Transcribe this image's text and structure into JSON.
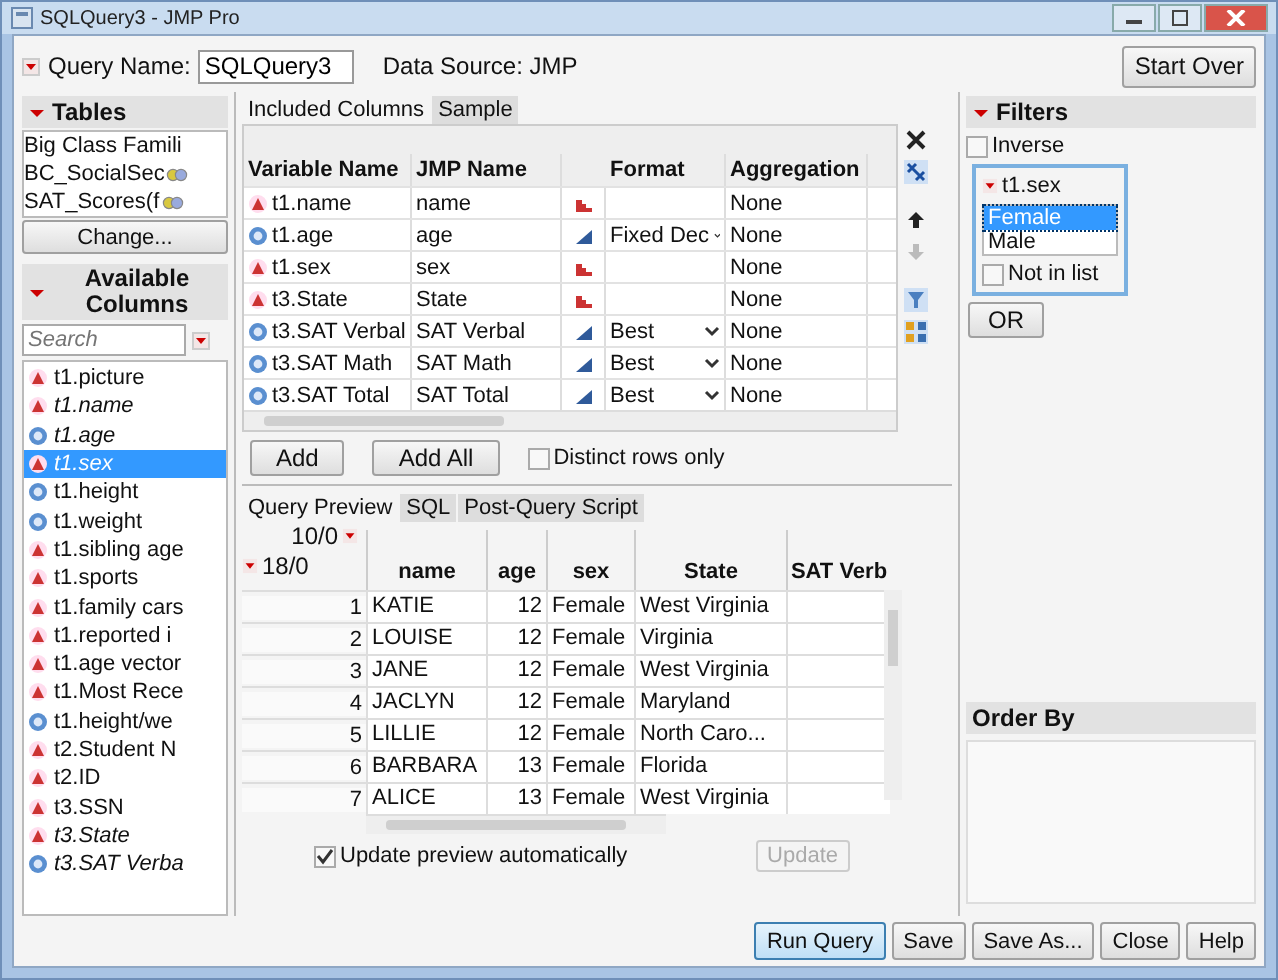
{
  "window": {
    "title": "SQLQuery3 - JMP Pro"
  },
  "query_name": {
    "label": "Query Name:",
    "value": "SQLQuery3"
  },
  "data_source": "Data Source:  JMP",
  "start_over": "Start Over",
  "tables": {
    "title": "Tables",
    "items": [
      {
        "name": "Big Class Famili",
        "linked": false
      },
      {
        "name": "BC_SocialSec",
        "linked": true
      },
      {
        "name": "SAT_Scores(f",
        "linked": true
      }
    ],
    "button": "Change..."
  },
  "available": {
    "title": "Available Columns",
    "search_placeholder": "Search",
    "items": [
      {
        "name": "t1.picture",
        "kind": "nominal",
        "included": false,
        "selected": false
      },
      {
        "name": "t1.name",
        "kind": "nominal",
        "included": true,
        "selected": false
      },
      {
        "name": "t1.age",
        "kind": "continuous",
        "included": true,
        "selected": false
      },
      {
        "name": "t1.sex",
        "kind": "nominal",
        "included": true,
        "selected": true
      },
      {
        "name": "t1.height",
        "kind": "continuous",
        "included": false,
        "selected": false
      },
      {
        "name": "t1.weight",
        "kind": "continuous",
        "included": false,
        "selected": false
      },
      {
        "name": "t1.sibling age",
        "kind": "nominal",
        "included": false,
        "selected": false
      },
      {
        "name": "t1.sports",
        "kind": "nominal",
        "included": false,
        "selected": false
      },
      {
        "name": "t1.family cars",
        "kind": "nominal",
        "included": false,
        "selected": false
      },
      {
        "name": "t1.reported i",
        "kind": "nominal",
        "included": false,
        "selected": false
      },
      {
        "name": "t1.age vector",
        "kind": "nominal",
        "included": false,
        "selected": false
      },
      {
        "name": "t1.Most Rece",
        "kind": "nominal",
        "included": false,
        "selected": false
      },
      {
        "name": "t1.height/we",
        "kind": "continuous",
        "included": false,
        "selected": false
      },
      {
        "name": "t2.Student N",
        "kind": "nominal",
        "included": false,
        "selected": false
      },
      {
        "name": "t2.ID",
        "kind": "nominal",
        "included": false,
        "selected": false
      },
      {
        "name": "t3.SSN",
        "kind": "nominal",
        "included": false,
        "selected": false
      },
      {
        "name": "t3.State",
        "kind": "nominal",
        "included": true,
        "selected": false
      },
      {
        "name": "t3.SAT Verba",
        "kind": "continuous",
        "included": true,
        "selected": false
      }
    ]
  },
  "included_tabs": [
    {
      "label": "Included Columns",
      "selected": true
    },
    {
      "label": "Sample",
      "selected": false
    }
  ],
  "included": {
    "columns": [
      "Variable Name",
      "JMP Name",
      "Format",
      "Aggregation"
    ],
    "rows": [
      {
        "variable": "t1.name",
        "jmp_name": "name",
        "kind": "nominal",
        "format": "",
        "format_menu": false,
        "aggregation": "None"
      },
      {
        "variable": "t1.age",
        "jmp_name": "age",
        "kind": "continuous",
        "format": "Fixed Dec",
        "format_menu": true,
        "aggregation": "None"
      },
      {
        "variable": "t1.sex",
        "jmp_name": "sex",
        "kind": "nominal",
        "format": "",
        "format_menu": false,
        "aggregation": "None"
      },
      {
        "variable": "t3.State",
        "jmp_name": "State",
        "kind": "nominal",
        "format": "",
        "format_menu": false,
        "aggregation": "None"
      },
      {
        "variable": "t3.SAT Verbal",
        "jmp_name": "SAT Verbal",
        "kind": "continuous",
        "format": "Best",
        "format_menu": true,
        "aggregation": "None"
      },
      {
        "variable": "t3.SAT Math",
        "jmp_name": "SAT Math",
        "kind": "continuous",
        "format": "Best",
        "format_menu": true,
        "aggregation": "None"
      },
      {
        "variable": "t3.SAT Total",
        "jmp_name": "SAT Total",
        "kind": "continuous",
        "format": "Best",
        "format_menu": true,
        "aggregation": "None"
      }
    ]
  },
  "add_buttons": [
    "Add",
    "Add All"
  ],
  "distinct_rows": {
    "label": "Distinct rows only",
    "checked": false
  },
  "preview_tabs": [
    {
      "label": "Query Preview",
      "selected": true
    },
    {
      "label": "SQL",
      "selected": false
    },
    {
      "label": "Post-Query Script",
      "selected": false
    }
  ],
  "preview": {
    "col_count": "10/0",
    "row_count": "18/0",
    "columns": [
      "",
      "name",
      "age",
      "sex",
      "State",
      "SAT Verb"
    ],
    "rows": [
      [
        "1",
        "KATIE",
        "12",
        "Female",
        "West Virginia",
        ""
      ],
      [
        "2",
        "LOUISE",
        "12",
        "Female",
        "Virginia",
        ""
      ],
      [
        "3",
        "JANE",
        "12",
        "Female",
        "West Virginia",
        ""
      ],
      [
        "4",
        "JACLYN",
        "12",
        "Female",
        "Maryland",
        ""
      ],
      [
        "5",
        "LILLIE",
        "12",
        "Female",
        "North Caro...",
        ""
      ],
      [
        "6",
        "BARBARA",
        "13",
        "Female",
        "Florida",
        ""
      ],
      [
        "7",
        "ALICE",
        "13",
        "Female",
        "West Virginia",
        ""
      ]
    ]
  },
  "update_auto": {
    "label": "Update preview automatically",
    "checked": true
  },
  "update_button": {
    "label": "Update",
    "disabled": true
  },
  "filters": {
    "title": "Filters",
    "inverse": {
      "label": "Inverse",
      "checked": false
    },
    "filter": {
      "title": "t1.sex",
      "values": [
        {
          "label": "Female",
          "selected": true
        },
        {
          "label": "Male",
          "selected": false
        }
      ],
      "not_in_list": {
        "label": "Not in list",
        "checked": false
      }
    },
    "or_button": "OR"
  },
  "order_by": {
    "title": "Order By"
  },
  "footer_buttons": [
    {
      "label": "Run Query",
      "default": true
    },
    {
      "label": "Save",
      "default": false
    },
    {
      "label": "Save As...",
      "default": false
    },
    {
      "label": "Close",
      "default": false
    },
    {
      "label": "Help",
      "default": false
    }
  ]
}
